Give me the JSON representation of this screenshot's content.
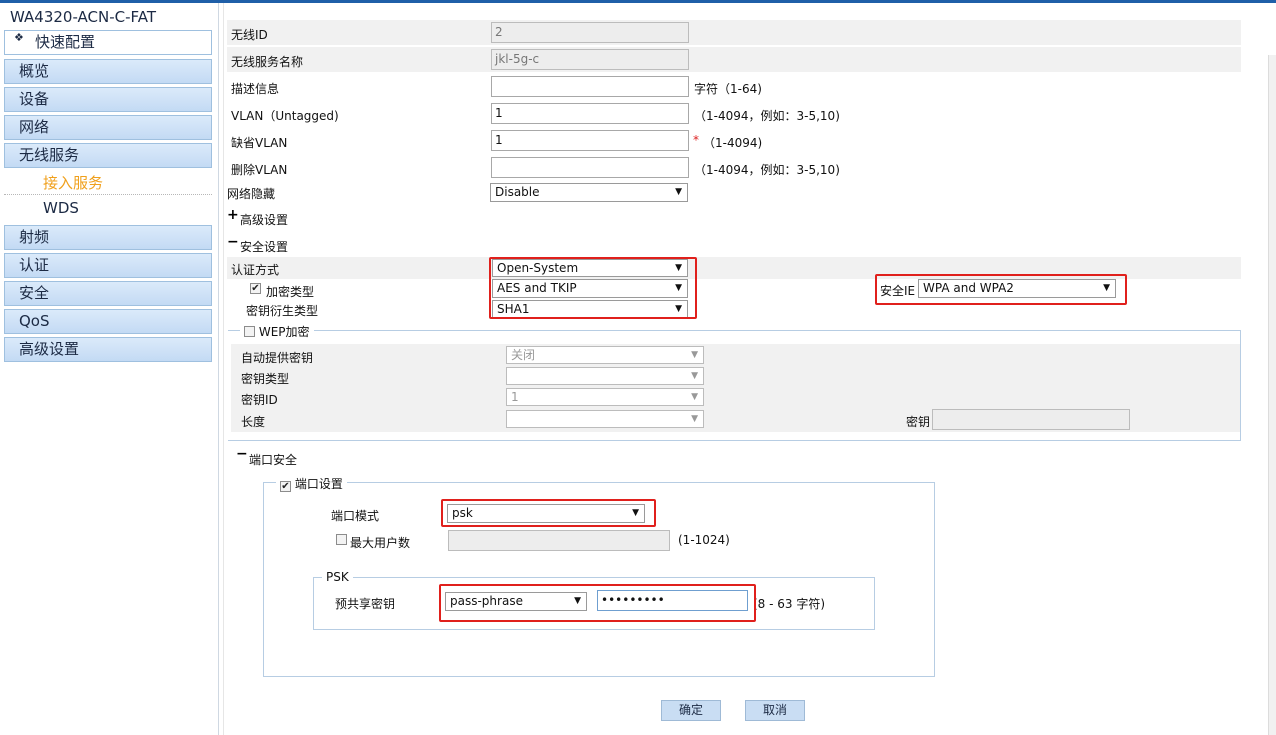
{
  "sidebar": {
    "device": "WA4320-ACN-C-FAT",
    "quick_config": "快速配置",
    "items": [
      "概览",
      "设备",
      "网络",
      "无线服务"
    ],
    "sub_items": [
      "接入服务",
      "WDS"
    ],
    "items2": [
      "射频",
      "认证",
      "安全",
      "QoS",
      "高级设置"
    ]
  },
  "form": {
    "wlan_id_label": "无线ID",
    "wlan_id_value": "2",
    "ssid_label": "无线服务名称",
    "ssid_value": "jkl-5g-c",
    "desc_label": "描述信息",
    "desc_value": "",
    "desc_hint": "字符（1-64)",
    "vlan_untagged_label": "VLAN（Untagged)",
    "vlan_untagged_value": "1",
    "vlan_untagged_hint": "（1-4094，例如：3-5,10)",
    "default_vlan_label": "缺省VLAN",
    "default_vlan_value": "1",
    "default_vlan_star": "*",
    "default_vlan_hint": "（1-4094)",
    "delete_vlan_label": "删除VLAN",
    "delete_vlan_value": "",
    "delete_vlan_hint": "（1-4094，例如：3-5,10)",
    "hide_label": "网络隐藏",
    "hide_value": "Disable",
    "advanced_label": "高级设置",
    "advanced_toggle": "+",
    "security_label": "安全设置",
    "security_toggle": "−"
  },
  "security": {
    "auth_label": "认证方式",
    "auth_value": "Open-System",
    "cipher_label": "加密类型",
    "cipher_value": "AES and TKIP",
    "akm_label": "密钥衍生类型",
    "akm_value": "SHA1",
    "ie_label": "安全IE",
    "ie_value": "WPA and WPA2",
    "wep_label": "WEP加密",
    "wep_auto_label": "自动提供密钥",
    "wep_auto_value": "关闭",
    "wep_keytype_label": "密钥类型",
    "wep_keytype_value": "",
    "wep_keyid_label": "密钥ID",
    "wep_keyid_value": "1",
    "wep_length_label": "长度",
    "wep_length_value": "",
    "wep_key_label": "密钥",
    "wep_key_value": ""
  },
  "port_security": {
    "title": "端口安全",
    "toggle": "−",
    "port_settings_label": "端口设置",
    "port_mode_label": "端口模式",
    "port_mode_value": "psk",
    "max_users_label": "最大用户数",
    "max_users_value": "",
    "max_users_hint": "(1-1024)",
    "psk_legend": "PSK",
    "psk_label": "预共享密钥",
    "psk_type_value": "pass-phrase",
    "psk_value": "•••••••••",
    "psk_hint": "(8 - 63 字符)"
  },
  "buttons": {
    "ok": "确定",
    "cancel": "取消"
  },
  "icons": {
    "dropdown": "triangle-down-icon",
    "quick": "diamond-icon",
    "checkbox": "checkmark-icon"
  },
  "colors": {
    "accent": "#1f5fa8",
    "highlight_box": "#e0201c",
    "active_submenu": "#f0a01c"
  }
}
